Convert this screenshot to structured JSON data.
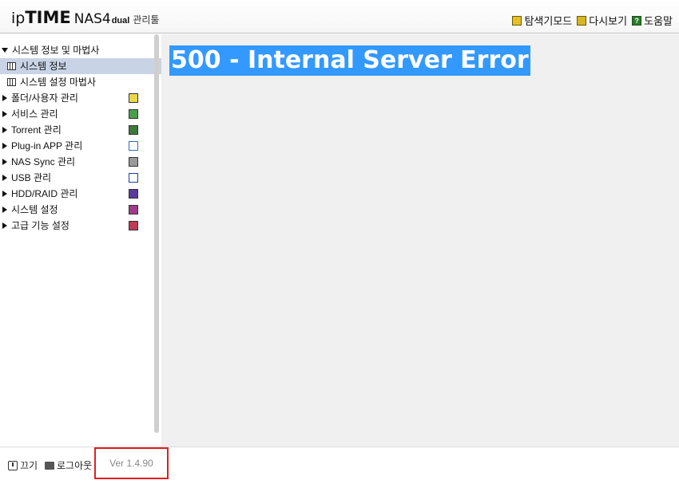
{
  "header": {
    "logo": {
      "ip": "ip",
      "time": "TIME",
      "nas": "NAS4",
      "dual": "dual",
      "admin": "관리툴"
    },
    "links": [
      {
        "label": "탐색기모드",
        "icon": "explorer-icon"
      },
      {
        "label": "다시보기",
        "icon": "refresh-icon"
      },
      {
        "label": "도움말",
        "icon": "help-icon"
      }
    ]
  },
  "sidebar": {
    "menu": [
      {
        "label": "시스템 정보 및 마법사",
        "expanded": true
      },
      {
        "label": "시스템 정보",
        "selected": true
      },
      {
        "label": "시스템 설정 마법사"
      },
      {
        "label": "폴더/사용자 관리"
      },
      {
        "label": "서비스 관리"
      },
      {
        "label": "Torrent 관리"
      },
      {
        "label": "Plug-in APP 관리"
      },
      {
        "label": "NAS Sync 관리"
      },
      {
        "label": "USB 관리"
      },
      {
        "label": "HDD/RAID 관리"
      },
      {
        "label": "시스템 설정"
      },
      {
        "label": "고급 기능 설정"
      }
    ]
  },
  "content": {
    "error_text": "500 - Internal Server Error"
  },
  "footer": {
    "power_label": "끄기",
    "logout_label": "로그아웃",
    "version": "Ver 1.4.90"
  },
  "colors": {
    "error_highlight": "#3399ff",
    "selected_row": "#c8d4e6",
    "version_box_border": "#e02020"
  }
}
